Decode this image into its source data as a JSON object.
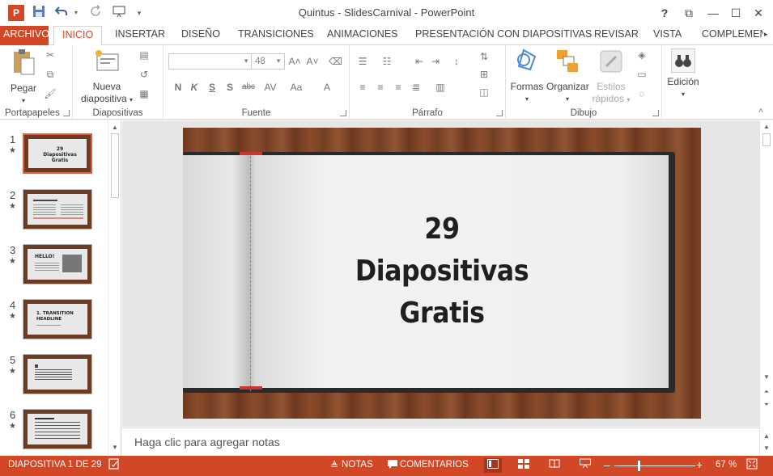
{
  "window": {
    "title": "Quintus - SlidesCarnival - PowerPoint",
    "app_icon_letter": "P",
    "help": "?",
    "ribbon_display": "⧉",
    "minimize": "—",
    "maximize": "☐",
    "close": "✕"
  },
  "tabs": [
    {
      "label": "ARCHIVO"
    },
    {
      "label": "INICIO"
    },
    {
      "label": "INSERTAR"
    },
    {
      "label": "DISEÑO"
    },
    {
      "label": "TRANSICIONES"
    },
    {
      "label": "ANIMACIONES"
    },
    {
      "label": "PRESENTACIÓN CON DIAPOSITIVAS"
    },
    {
      "label": "REVISAR"
    },
    {
      "label": "VISTA"
    },
    {
      "label": "COMPLEMEN"
    }
  ],
  "ribbon": {
    "clipboard": {
      "label": "Portapapeles",
      "paste": "Pegar"
    },
    "slides": {
      "label": "Diapositivas",
      "new_slide_line1": "Nueva",
      "new_slide_line2": "diapositiva"
    },
    "font": {
      "label": "Fuente",
      "font_name": "",
      "font_size": "48"
    },
    "paragraph": {
      "label": "Párrafo"
    },
    "drawing": {
      "label": "Dibujo",
      "shapes": "Formas",
      "arrange": "Organizar",
      "quick_styles_line1": "Estilos",
      "quick_styles_line2": "rápidos"
    },
    "editing": {
      "label": "Edición"
    }
  },
  "thumbnails": [
    {
      "number": "1",
      "title": "29 Diapositivas Gratis",
      "selected": true
    },
    {
      "number": "2",
      "selected": false
    },
    {
      "number": "3",
      "title": "HELLO!",
      "selected": false
    },
    {
      "number": "4",
      "title": "1. TRANSITION HEADLINE",
      "selected": false
    },
    {
      "number": "5",
      "selected": false
    },
    {
      "number": "6",
      "selected": false
    }
  ],
  "slide": {
    "title": "29\nDiapositivas\nGratis"
  },
  "notes": {
    "placeholder": "Haga clic para agregar notas"
  },
  "statusbar": {
    "slide_info": "DIAPOSITIVA 1 DE 29",
    "notes": "NOTAS",
    "comments": "COMENTARIOS",
    "zoom": "67 %",
    "zoom_fraction": 0.3
  },
  "colors": {
    "accent": "#d24726",
    "selected_thumb_border": "#e06040"
  }
}
